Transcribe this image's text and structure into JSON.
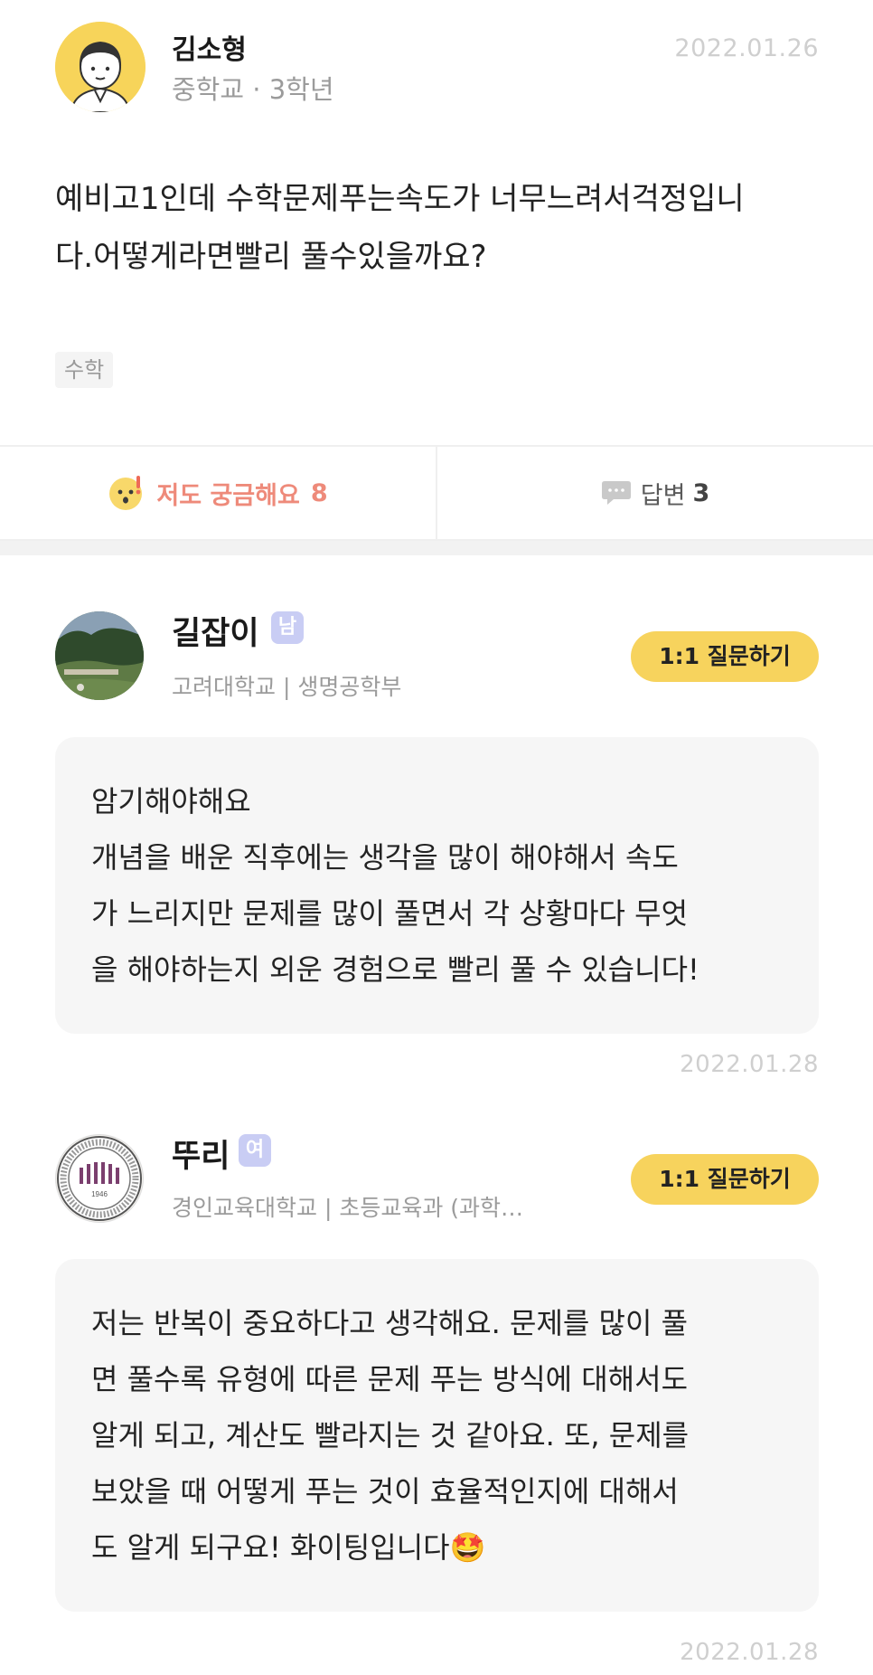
{
  "question": {
    "author": "김소형",
    "school": "중학교 · 3학년",
    "date": "2022.01.26",
    "body": "예비고1인데 수학문제푸는속도가 너무느려서걱정입니\n다.어떻게라면빨리 풀수있을까요?",
    "tag": "수학"
  },
  "actions": {
    "curious_label": "저도 궁금해요",
    "curious_count": "8",
    "answers_label": "답변",
    "answers_count": "3"
  },
  "answers": [
    {
      "name": "길잡이",
      "gender": "남",
      "school": "고려대학교 | 생명공학부",
      "ask_label": "1:1 질문하기",
      "body": "암기해야해요\n개념을 배운 직후에는 생각을 많이 해야해서 속도\n가 느리지만 문제를 많이 풀면서 각 상황마다 무엇\n을 해야하는지 외운 경험으로 빨리 풀 수 있습니다!",
      "date": "2022.01.28"
    },
    {
      "name": "뚜리",
      "gender": "여",
      "school": "경인교육대학교 | 초등교육과 (과학…",
      "ask_label": "1:1 질문하기",
      "body": "저는 반복이 중요하다고 생각해요. 문제를 많이 풀\n면 풀수록 유형에 따른 문제 푸는 방식에 대해서도\n알게 되고, 계산도 빨라지는 것 같아요. 또, 문제를\n보았을 때 어떻게 푸는 것이 효율적인지에 대해서\n도 알게 되구요! 화이팅입니다",
      "emoji": "🤩",
      "seal_year": "1946",
      "date": "2022.01.28"
    }
  ],
  "colors": {
    "accent_yellow": "#f7d35d",
    "curious_red": "#ee8a7a",
    "badge_lavender": "#c9cdf4",
    "card_bg": "#f6f6f6"
  }
}
